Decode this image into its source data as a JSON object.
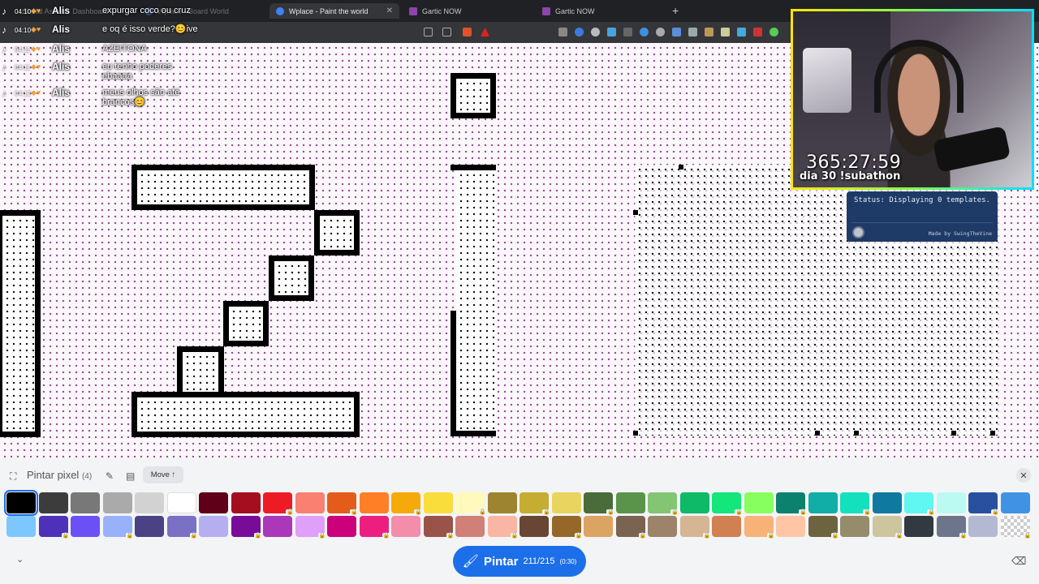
{
  "browser": {
    "tabs": [
      {
        "label": "Social Assets - Dashboard",
        "active": false
      },
      {
        "label": "Wplace - Board World",
        "active": false
      },
      {
        "label": "Wplace - Paint the world",
        "active": true
      },
      {
        "label": "Gartic NOW",
        "active": false
      },
      {
        "label": "Gartic NOW",
        "active": false
      }
    ],
    "new_tab": "+",
    "close_glyph": "✕"
  },
  "chat": [
    {
      "time": "04:10",
      "user": "Alis",
      "message": "expurgar coco ou cruz"
    },
    {
      "time": "04:10",
      "user": "Alis",
      "message": "e oq é isso verde?😊ive"
    },
    {
      "time": "04:11",
      "user": "Alis",
      "message": "AZEITONA"
    },
    {
      "time": "04:11",
      "user": "Alis",
      "message": "eu tenho poderes ebaaaa"
    },
    {
      "time": "04:12",
      "user": "Alis",
      "message": "meus olhos são até brancos😊"
    }
  ],
  "webcam": {
    "timer": "365:27:59",
    "caption": "dia 30 !subathon"
  },
  "status_panel": {
    "text": "Status: Displaying 0 templates.",
    "credit": "Made by SwingTheVine"
  },
  "paint_panel": {
    "title": "Pintar pixel",
    "count": "(4)",
    "move_label": "Move ↑",
    "close_glyph": "✕",
    "paint_label": "Pintar",
    "paint_charges": "211/215",
    "paint_timer": "(0:30)",
    "palette_row1": [
      "#000000",
      "#3c3c3c",
      "#787878",
      "#aaaaaa",
      "#d2d2d2",
      "#ffffff",
      "#600018",
      "#a50e1e",
      "#ed1c24",
      "#fa8072",
      "#e45c1a",
      "#ff7f27",
      "#f6aa09",
      "#f9dd3b",
      "#fffabc",
      "#9c8431",
      "#c5ad31",
      "#e8d45f",
      "#4a6b3a",
      "#5a944a",
      "#84c573",
      "#0eb968",
      "#13e67b",
      "#87ff5e",
      "#0c816e",
      "#10aea6",
      "#13e1be",
      "#0f799f",
      "#60f7f2",
      "#bbfaf2",
      "#28509e",
      "#4093e4"
    ],
    "palette_row2": [
      "#7dc7ff",
      "#4d31b8",
      "#6b50f6",
      "#99b1fb",
      "#4a4284",
      "#7a71c4",
      "#b5aef1",
      "#780c99",
      "#aa38b9",
      "#e09ff9",
      "#cb007a",
      "#ec1f80",
      "#f38da9",
      "#9b5249",
      "#d18078",
      "#fab6a4",
      "#684634",
      "#95682a",
      "#dba463",
      "#7b6352",
      "#9c846b",
      "#d6b594",
      "#d18051",
      "#f8b277",
      "#ffc5a5",
      "#6d643f",
      "#948c6b",
      "#cdc59e",
      "#333941",
      "#6d758d",
      "#b3b9d1",
      "transparent"
    ],
    "selected_index": 0
  }
}
